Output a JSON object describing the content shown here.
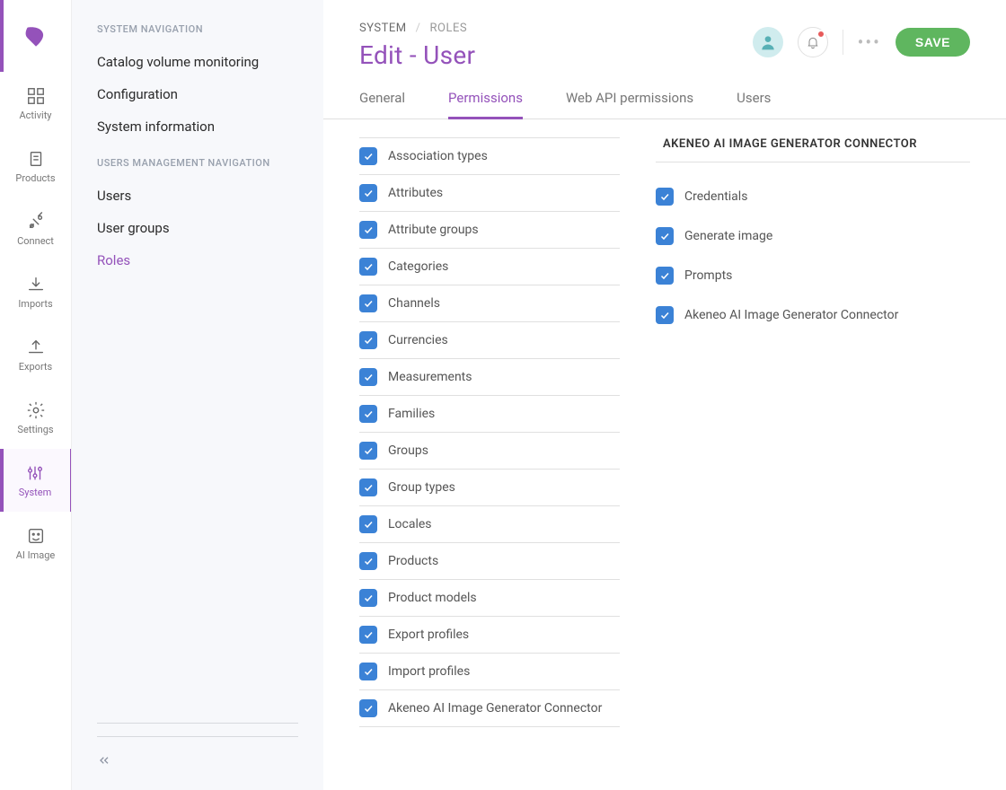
{
  "rail": {
    "items": [
      {
        "label": "Activity"
      },
      {
        "label": "Products"
      },
      {
        "label": "Connect"
      },
      {
        "label": "Imports"
      },
      {
        "label": "Exports"
      },
      {
        "label": "Settings"
      },
      {
        "label": "System",
        "active": true
      },
      {
        "label": "AI Image"
      }
    ]
  },
  "secnav": {
    "group1_title": "SYSTEM NAVIGATION",
    "group1": [
      {
        "label": "Catalog volume monitoring"
      },
      {
        "label": "Configuration"
      },
      {
        "label": "System information"
      }
    ],
    "group2_title": "USERS MANAGEMENT NAVIGATION",
    "group2": [
      {
        "label": "Users"
      },
      {
        "label": "User groups"
      },
      {
        "label": "Roles",
        "active": true
      }
    ]
  },
  "breadcrumbs": {
    "system": "SYSTEM",
    "roles": "ROLES"
  },
  "page_title": "Edit - User",
  "save_label": "SAVE",
  "tabs": [
    {
      "label": "General"
    },
    {
      "label": "Permissions",
      "active": true
    },
    {
      "label": "Web API permissions"
    },
    {
      "label": "Users"
    }
  ],
  "permissions_left": [
    "Association types",
    "Attributes",
    "Attribute groups",
    "Categories",
    "Channels",
    "Currencies",
    "Measurements",
    "Families",
    "Groups",
    "Group types",
    "Locales",
    "Products",
    "Product models",
    "Export profiles",
    "Import profiles",
    "Akeneo AI Image Generator Connector"
  ],
  "right_panel": {
    "title": "AKENEO AI IMAGE GENERATOR CONNECTOR",
    "options": [
      "Credentials",
      "Generate image",
      "Prompts",
      "Akeneo AI Image Generator Connector"
    ]
  }
}
